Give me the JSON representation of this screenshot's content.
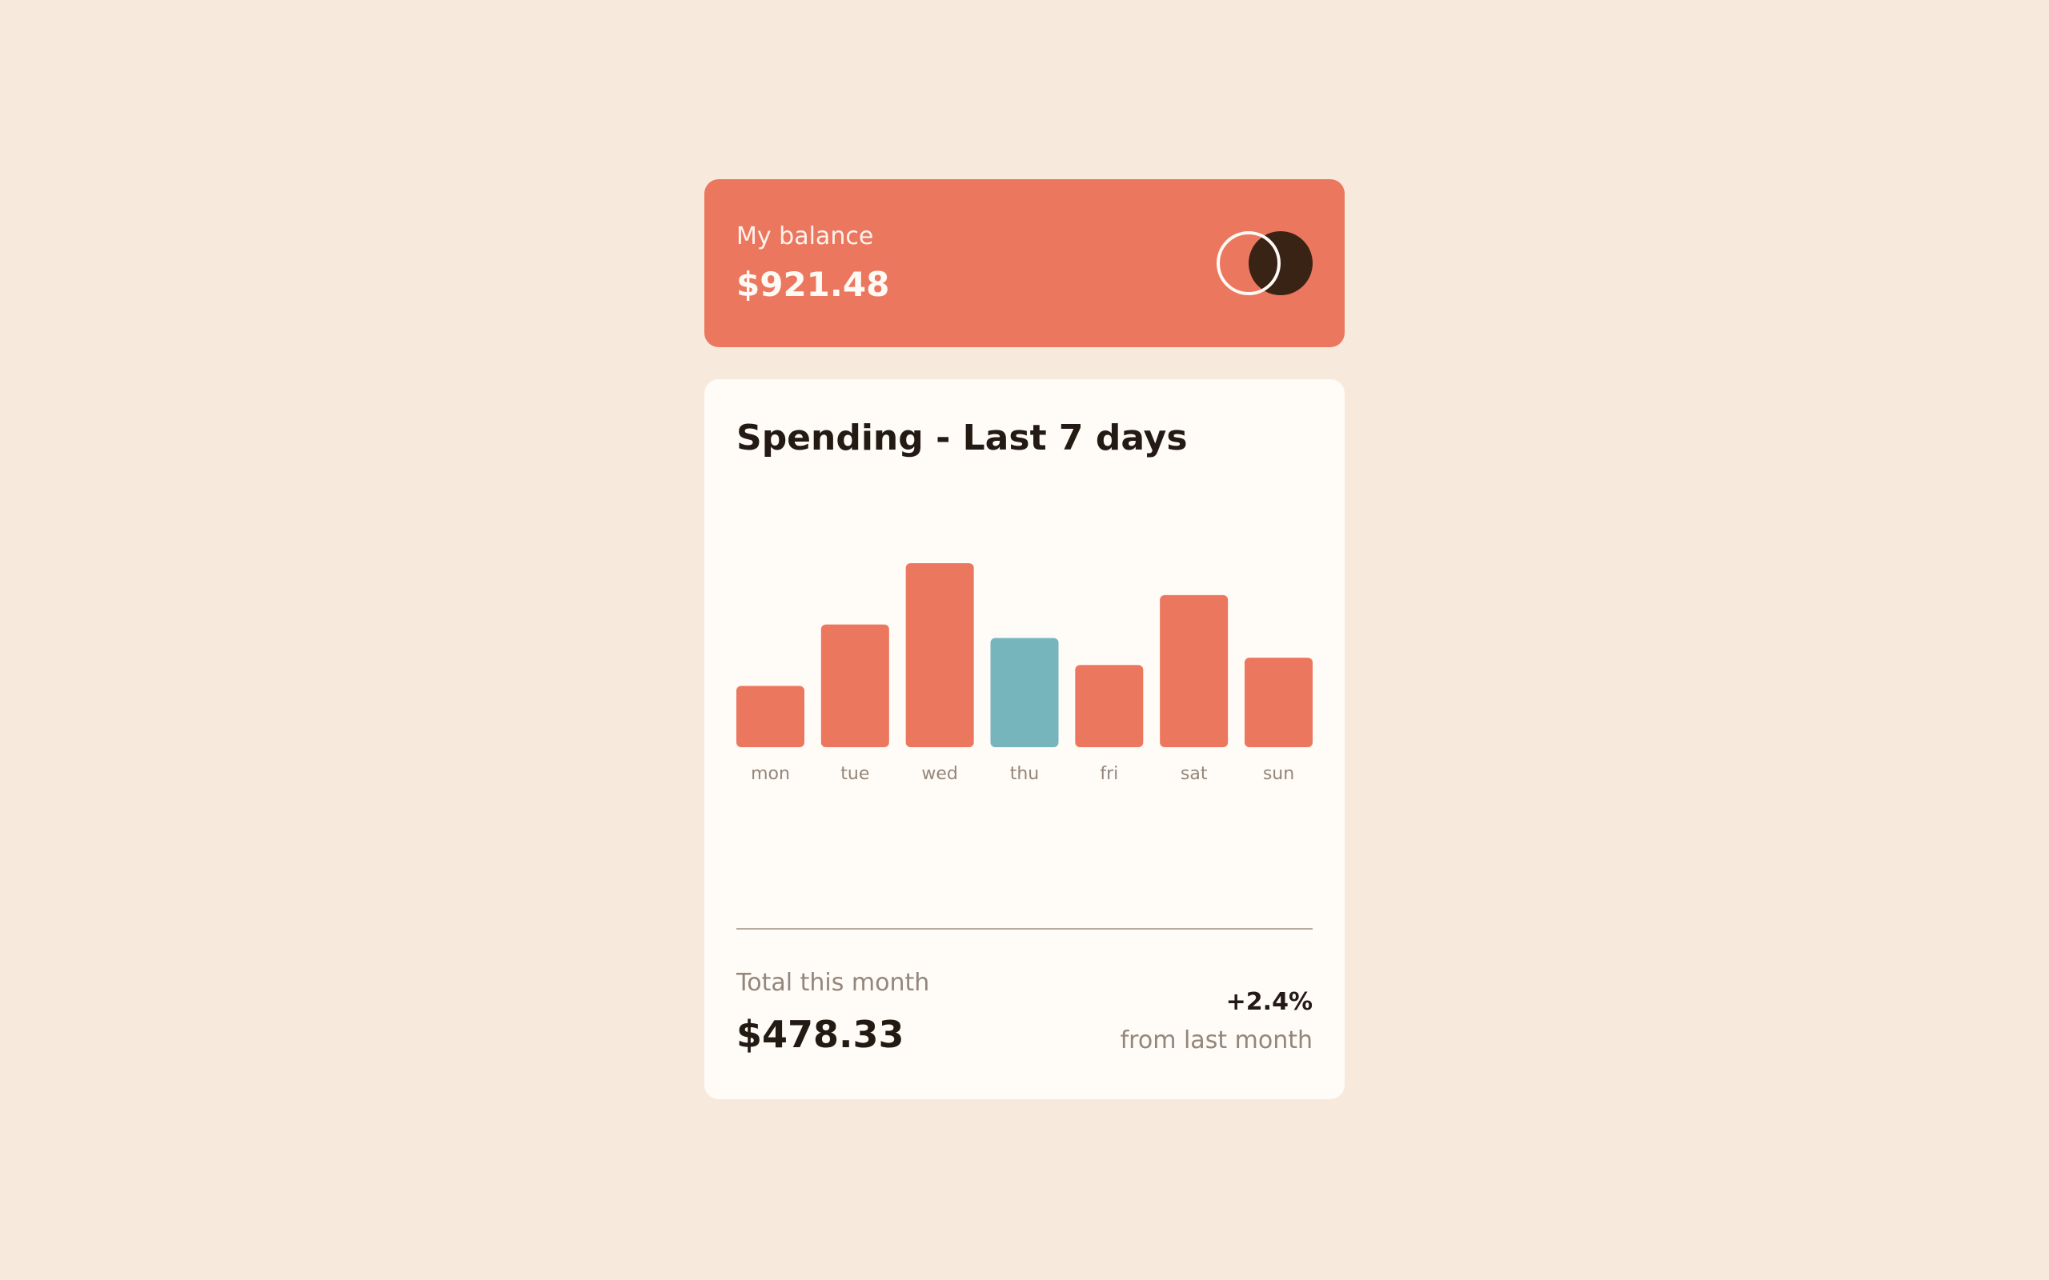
{
  "balance": {
    "label": "My balance",
    "amount": "$921.48",
    "logo_icon": "overlapping-circles-logo-icon"
  },
  "spending": {
    "title": "Spending - Last 7 days",
    "total_label": "Total this month",
    "total_amount": "$478.33",
    "change_percent": "+2.4%",
    "change_label": "from last month"
  },
  "colors": {
    "bar": "#ec775f",
    "bar_highlight": "#76b5bc",
    "page_background": "#f8e9dd",
    "card_background": "#fffbf6",
    "dark_brown": "#382314"
  },
  "chart_data": {
    "type": "bar",
    "categories": [
      "mon",
      "tue",
      "wed",
      "thu",
      "fri",
      "sat",
      "sun"
    ],
    "values": [
      17.45,
      34.91,
      52.36,
      31.07,
      23.39,
      43.28,
      25.48
    ],
    "highlight_index": 3,
    "ylim": [
      0,
      52.36
    ],
    "grid": false
  }
}
